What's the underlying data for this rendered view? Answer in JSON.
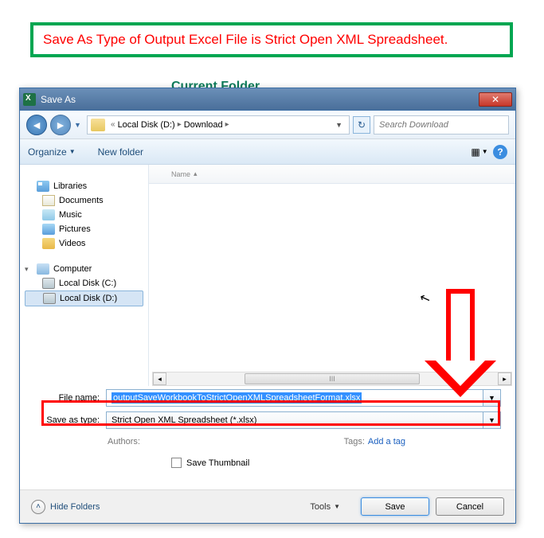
{
  "callout": "Save As Type of Output Excel File is Strict Open XML Spreadsheet.",
  "bg_label": "Current Folder",
  "dialog": {
    "title": "Save As",
    "close": "✕",
    "breadcrumb": {
      "root_arrow": "«",
      "item1": "Local Disk (D:)",
      "item2": "Download"
    },
    "search_placeholder": "Search Download",
    "toolbar": {
      "organize": "Organize",
      "newfolder": "New folder"
    },
    "content_header": "Name",
    "navpane": {
      "libraries": "Libraries",
      "documents": "Documents",
      "music": "Music",
      "pictures": "Pictures",
      "videos": "Videos",
      "computer": "Computer",
      "drive_c": "Local Disk (C:)",
      "drive_d": "Local Disk (D:)"
    },
    "scroll_thumb": "III",
    "form": {
      "filename_label": "File name:",
      "filename_value": "outputSaveWorkbookToStrictOpenXMLSpreadsheetFormat.xlsx",
      "savetype_label": "Save as type:",
      "savetype_value": "Strict Open XML Spreadsheet (*.xlsx)"
    },
    "meta": {
      "authors_label": "Authors:",
      "tags_label": "Tags:",
      "tags_link": "Add a tag"
    },
    "thumbnail_label": "Save Thumbnail",
    "footer": {
      "hide_folders": "Hide Folders",
      "tools": "Tools",
      "save": "Save",
      "cancel": "Cancel"
    }
  }
}
